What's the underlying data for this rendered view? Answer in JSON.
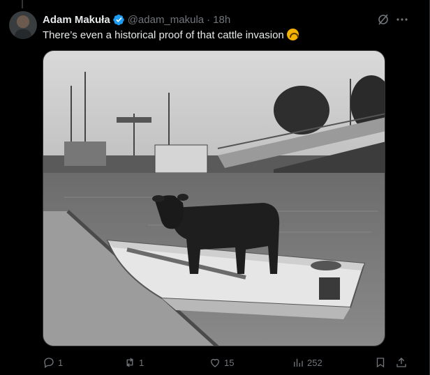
{
  "tweet": {
    "author_name": "Adam Makuła",
    "handle": "@adam_makula",
    "separator": "·",
    "time": "18h",
    "text": "There’s even a historical proof of that cattle invasion",
    "emoji_icon": "upside-down-face-icon"
  },
  "actions": {
    "replies": "1",
    "reposts": "1",
    "likes": "15",
    "views": "252"
  },
  "colors": {
    "background": "#000000",
    "text_primary": "#e7e9ea",
    "text_secondary": "#71767b",
    "verified_blue": "#1d9bf0"
  }
}
